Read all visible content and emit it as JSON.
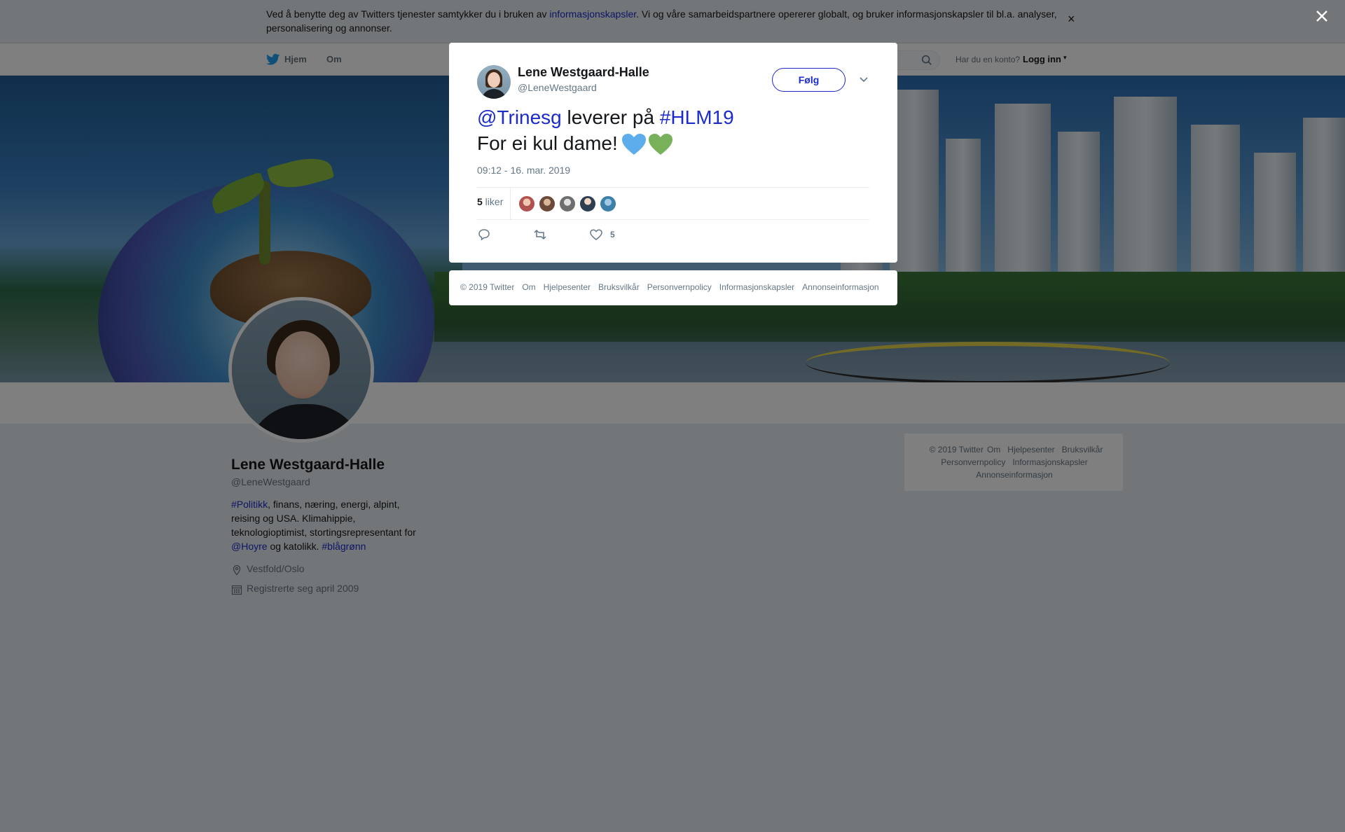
{
  "cookie": {
    "text_before": "Ved å benytte deg av Twitters tjenester samtykker du i bruken av ",
    "link": "informasjonskapsler",
    "text_after": ". Vi og våre samarbeidspartnere opererer globalt, og bruker informasjonskapsler til bl.a. analyser, personalisering og annonser.",
    "close": "×"
  },
  "nav": {
    "home": "Hjem",
    "about": "Om",
    "account_prompt": "Har du en konto?",
    "login": "Logg inn",
    "login_caret": "▾"
  },
  "profile": {
    "name": "Lene Westgaard-Halle",
    "handle": "@LeneWestgaard",
    "bio_tag1": "#Politikk",
    "bio_text1": ", finans, næring, energi, alpint, reising og USA. Klimahippie, teknologioptimist, stortingsrepresentant for ",
    "bio_tag2": "@Hoyre",
    "bio_text2": " og katolikk. ",
    "bio_tag3": "#blågrønn",
    "location": "Vestfold/Oslo",
    "joined": "Registrerte seg april 2009"
  },
  "side_footer": {
    "links": [
      "© 2019 Twitter",
      "Om",
      "Hjelpesenter",
      "Bruksvilkår",
      "Personvernpolicy",
      "Informasjonskapsler",
      "Annonseinformasjon"
    ]
  },
  "tweet": {
    "author_name": "Lene Westgaard-Halle",
    "author_handle": "@LeneWestgaard",
    "follow_label": "Følg",
    "mention": "@Trinesg",
    "text_mid": " leverer på ",
    "hashtag": "#HLM19",
    "line2": "For ei kul dame!",
    "heart_colors": [
      "#5dadec",
      "#78b159"
    ],
    "timestamp": "09:12 - 16. mar. 2019",
    "likes_count": "5",
    "likes_label": " liker",
    "like_action_count": "5",
    "liker_colors": [
      "#b0524f",
      "#6b4a3a",
      "#8c8c8c",
      "#2d3e50",
      "#3c7fa8"
    ]
  },
  "modal_footer": {
    "links": [
      "© 2019 Twitter",
      "Om",
      "Hjelpesenter",
      "Bruksvilkår",
      "Personvernpolicy",
      "Informasjonskapsler",
      "Annonseinformasjon"
    ]
  },
  "colors": {
    "link": "#1b2bcc",
    "muted": "#657786",
    "overlay": "rgba(0,0,0,0.5)"
  }
}
